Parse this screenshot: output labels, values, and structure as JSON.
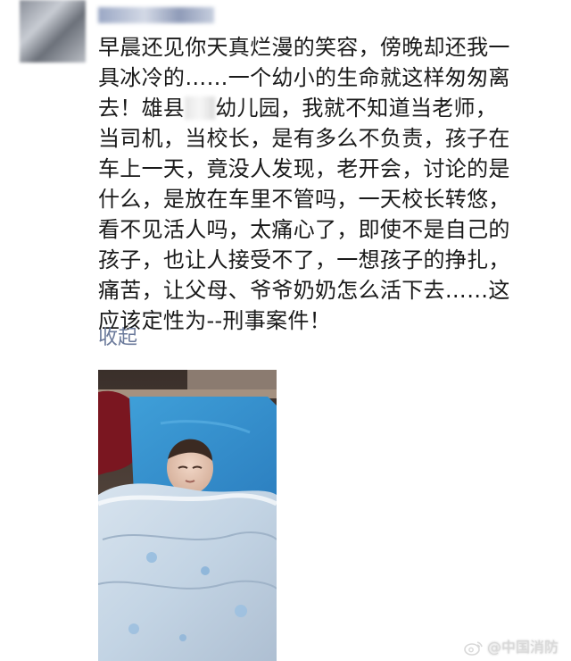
{
  "post": {
    "nickname": "▒▒▒▒▒▒▒",
    "text_lines": [
      "早晨还见你天真烂漫的笑容，傍晚却还我一",
      "具冰冷的……一个幼小的生命就这样匆匆离",
      "去！雄县",
      "幼儿园，我就不知道当老师，",
      "当司机，当校长，是有多么不负责，孩子在",
      "车上一天，竟没人发现，老开会，讨论的是",
      "什么，是放在车里不管吗，一天校长转悠，",
      "看不见活人吗，太痛心了，即使不是自己的",
      "孩子，也让人接受不了，一想孩子的挣扎，",
      "痛苦，让父母、爷爷奶奶怎么活下去……这",
      "应该定性为--刑事案件！"
    ],
    "collapse_label": "收起"
  },
  "watermark": {
    "text": "@中国消防",
    "icon": "weibo-icon"
  }
}
